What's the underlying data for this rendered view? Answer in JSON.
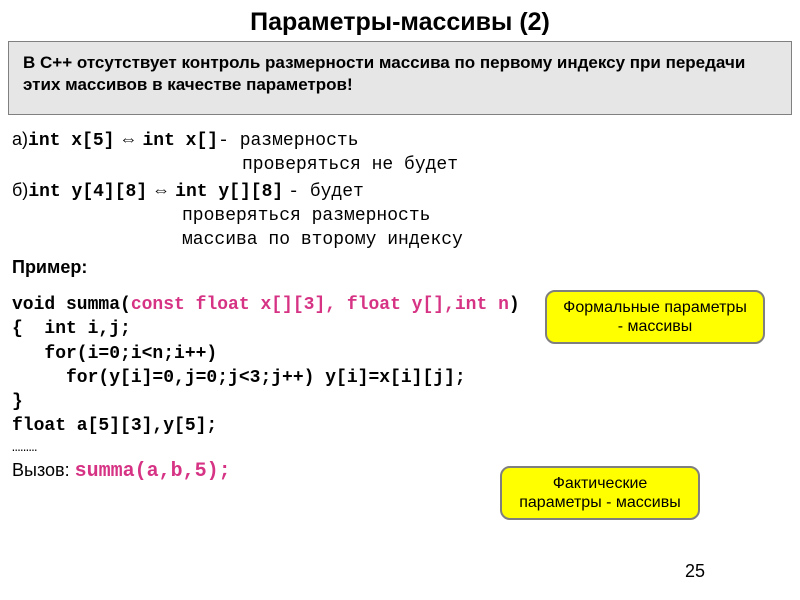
{
  "title": "Параметры-массивы (2)",
  "infobox": "В С++ отсутствует контроль размерности массива по первому индексу при передачи этих массивов в качестве параметров!",
  "lines": {
    "a_prefix": "а)",
    "a_code1": "int x[5]",
    "a_arrow": "⇔",
    "a_code2": "int x[]",
    "a_tail": "- размерность",
    "a_line2": "проверяться не будет",
    "b_prefix": "б)",
    "b_code1": "int y[4][8]",
    "b_arrow": "⇔",
    "b_code2": "int y[][8]",
    "b_tail": "- будет",
    "b_line2": "проверяться размерность",
    "b_line3": "массива по второму индексу"
  },
  "example_label": "Пример:",
  "code": {
    "l1a": "void summa(",
    "l1b": "const float x[][3], float y[],int n",
    "l1c": ")",
    "l2": "{  int i,j;",
    "l3": "   for(i=0;i<n;i++)",
    "l4": "     for(y[i]=0,j=0;j<3;j++) y[i]=x[i][j];",
    "l5": "}",
    "l6": "float a[5][3],y[5];",
    "l7": "………",
    "l8a": "Вызов: ",
    "l8b": "summa(a,b,5);"
  },
  "callouts": {
    "formal": "Формальные параметры - массивы",
    "actual": "Фактические параметры - массивы"
  },
  "page": "25"
}
